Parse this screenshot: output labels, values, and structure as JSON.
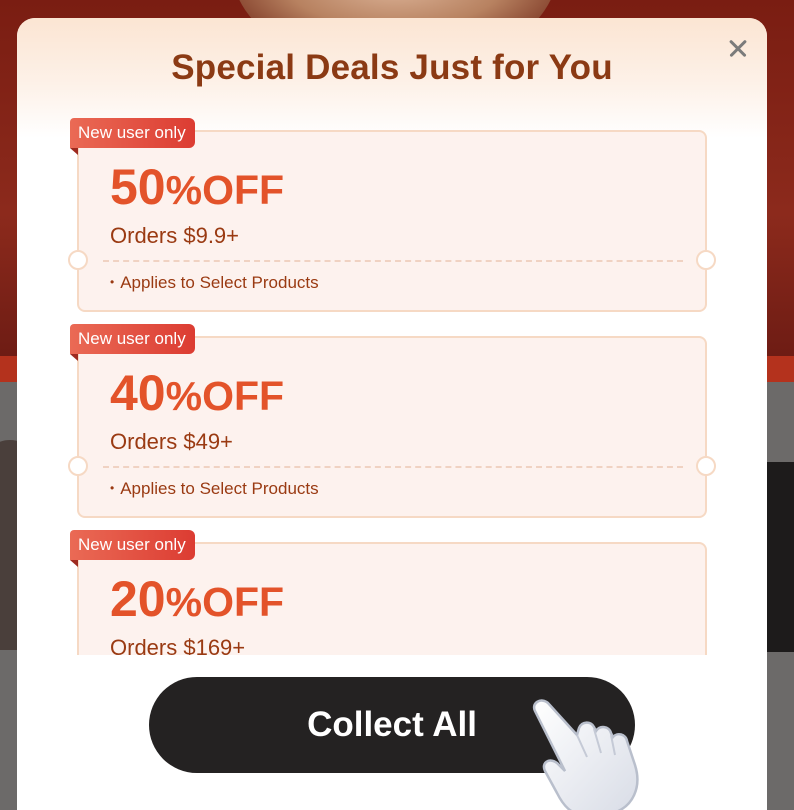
{
  "modal": {
    "title": "Special Deals Just for You",
    "close_icon": "close-icon",
    "coupons": [
      {
        "badge": "New user only",
        "percent": "50",
        "off": "%OFF",
        "min_order": "Orders $9.9+",
        "terms": "Applies to Select Products"
      },
      {
        "badge": "New user only",
        "percent": "40",
        "off": "%OFF",
        "min_order": "Orders $49+",
        "terms": "Applies to Select Products"
      },
      {
        "badge": "New user only",
        "percent": "20",
        "off": "%OFF",
        "min_order": "Orders $169+",
        "terms": ""
      }
    ],
    "collect_button": "Collect All",
    "pointer_icon": "hand-pointer-icon"
  },
  "colors": {
    "title": "#8b3a14",
    "discount": "#e3532a",
    "badge": "#dc3c32",
    "button": "#242222"
  }
}
